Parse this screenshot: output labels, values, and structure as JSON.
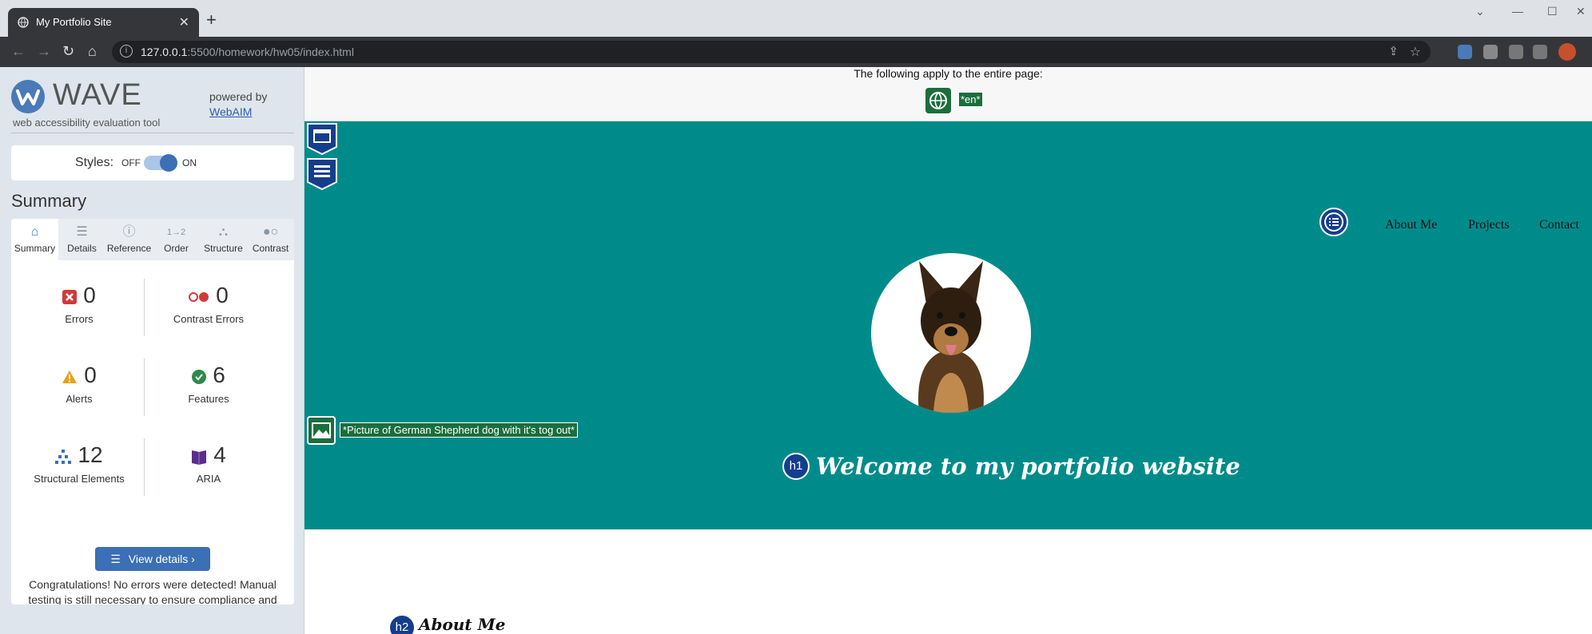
{
  "browser": {
    "tab_title": "My Portfolio Site",
    "url_host": "127.0.0.1",
    "url_path": ":5500/homework/hw05/index.html",
    "info_glyph": "i",
    "new_tab": "+",
    "tab_close": "✕",
    "window_controls": [
      "⌄",
      "—",
      "☐",
      "✕"
    ]
  },
  "wave": {
    "logo_text": "WAVE",
    "tagline": "web accessibility evaluation tool",
    "powered_by": "powered by",
    "webaim_link": "WebAIM",
    "styles_label": "Styles:",
    "styles_off": "OFF",
    "styles_on": "ON",
    "summary_heading": "Summary",
    "tabs": [
      {
        "label": "Summary",
        "icon": "home-icon"
      },
      {
        "label": "Details",
        "icon": "list-icon"
      },
      {
        "label": "Reference",
        "icon": "info-icon"
      },
      {
        "label": "Order",
        "icon": "order-icon"
      },
      {
        "label": "Structure",
        "icon": "structure-icon"
      },
      {
        "label": "Contrast",
        "icon": "contrast-icon"
      }
    ],
    "stats": [
      {
        "value": "0",
        "label": "Errors",
        "icon": "error-icon"
      },
      {
        "value": "0",
        "label": "Contrast Errors",
        "icon": "contrast-error-icon"
      },
      {
        "value": "0",
        "label": "Alerts",
        "icon": "alert-icon"
      },
      {
        "value": "6",
        "label": "Features",
        "icon": "feature-icon"
      },
      {
        "value": "12",
        "label": "Structural Elements",
        "icon": "structure-icon"
      },
      {
        "value": "4",
        "label": "ARIA",
        "icon": "aria-icon"
      }
    ],
    "view_details": "View details ›",
    "congrats": "Congratulations! No errors were detected! Manual testing is still necessary to ensure compliance and optimal accessibility."
  },
  "page": {
    "entire_page_note": "The following apply to the entire page:",
    "lang_tag": "*en*",
    "nav": [
      "About Me",
      "Projects",
      "Contact"
    ],
    "alt_text": "*Picture of German Shepherd dog with it's tog out*",
    "h1_badge": "h1",
    "h1": "Welcome to my portfolio website",
    "h2_badge": "h2",
    "h2": "About Me"
  },
  "colors": {
    "hero_bg": "#008b8b",
    "wave_blue": "#3b6fb6",
    "feature_green": "#1b6e3c",
    "structure_navy": "#143e8c"
  }
}
